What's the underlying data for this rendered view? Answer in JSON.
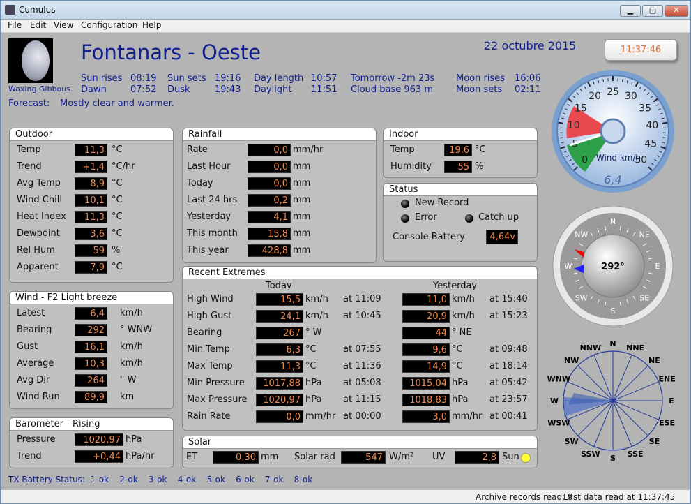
{
  "window": {
    "title": "Cumulus"
  },
  "menu": [
    "File",
    "Edit",
    "View",
    "Configuration",
    "Help"
  ],
  "header": {
    "station": "Fontanars - Oeste",
    "date": "22 octubre 2015",
    "clock": "11:37:46",
    "moon_phase": "Waxing Gibbous",
    "sun_rises_l": "Sun rises",
    "sun_rises": "08:19",
    "sun_sets_l": "Sun sets",
    "sun_sets": "19:16",
    "day_length_l": "Day length",
    "day_length": "10:57",
    "tomorrow": "Tomorrow -2m 23s",
    "moon_rises_l": "Moon rises",
    "moon_rises": "16:06",
    "dawn_l": "Dawn",
    "dawn": "07:52",
    "dusk_l": "Dusk",
    "dusk": "19:43",
    "daylight_l": "Daylight",
    "daylight": "11:51",
    "cloud_base": "Cloud base 963 m",
    "moon_sets_l": "Moon sets",
    "moon_sets": "02:11",
    "forecast_l": "Forecast:",
    "forecast": "Mostly clear and warmer."
  },
  "outdoor": {
    "title": "Outdoor",
    "rows": [
      {
        "label": "Temp",
        "value": "11,3",
        "unit": "°C"
      },
      {
        "label": "Trend",
        "value": "+1,4",
        "unit": "°C/hr"
      },
      {
        "label": "Avg Temp",
        "value": "8,9",
        "unit": "°C"
      },
      {
        "label": "Wind Chill",
        "value": "10,1",
        "unit": "°C"
      },
      {
        "label": "Heat Index",
        "value": "11,3",
        "unit": "°C"
      },
      {
        "label": "Dewpoint",
        "value": "3,6",
        "unit": "°C"
      },
      {
        "label": "Rel Hum",
        "value": "59",
        "unit": "%"
      },
      {
        "label": "Apparent",
        "value": "7,9",
        "unit": "°C"
      }
    ]
  },
  "rainfall": {
    "title": "Rainfall",
    "rows": [
      {
        "label": "Rate",
        "value": "0,0",
        "unit": "mm/hr"
      },
      {
        "label": "Last Hour",
        "value": "0,0",
        "unit": "mm"
      },
      {
        "label": "Today",
        "value": "0,0",
        "unit": "mm"
      },
      {
        "label": "Last 24 hrs",
        "value": "0,2",
        "unit": "mm"
      },
      {
        "label": "Yesterday",
        "value": "4,1",
        "unit": "mm"
      },
      {
        "label": "This month",
        "value": "15,8",
        "unit": "mm"
      },
      {
        "label": "This year",
        "value": "428,8",
        "unit": "mm"
      }
    ]
  },
  "indoor": {
    "title": "Indoor",
    "rows": [
      {
        "label": "Temp",
        "value": "19,6",
        "unit": "°C"
      },
      {
        "label": "Humidity",
        "value": "55",
        "unit": "%"
      }
    ]
  },
  "status": {
    "title": "Status",
    "new_record": "New Record",
    "error": "Error",
    "catch_up": "Catch up",
    "battery_l": "Console Battery",
    "battery": "4,64v"
  },
  "wind": {
    "title": "Wind - F2 Light breeze",
    "rows": [
      {
        "label": "Latest",
        "value": "6,4",
        "unit": "km/h"
      },
      {
        "label": "Bearing",
        "value": "292",
        "unit": "° WNW"
      },
      {
        "label": "Gust",
        "value": "16,1",
        "unit": "km/h"
      },
      {
        "label": "Average",
        "value": "10,3",
        "unit": "km/h"
      },
      {
        "label": "Avg Dir",
        "value": "264",
        "unit": "° W"
      },
      {
        "label": "Wind Run",
        "value": "89,9",
        "unit": "km"
      }
    ]
  },
  "barometer": {
    "title": "Barometer - Rising",
    "rows": [
      {
        "label": "Pressure",
        "value": "1020,97",
        "unit": "hPa"
      },
      {
        "label": "Trend",
        "value": "+0,44",
        "unit": "hPa/hr"
      }
    ]
  },
  "extremes": {
    "title": "Recent Extremes",
    "today_l": "Today",
    "yesterday_l": "Yesterday",
    "rows": [
      {
        "label": "High Wind",
        "t_val": "15,5",
        "t_unit": "km/h",
        "t_at": "at 11:09",
        "y_val": "11,0",
        "y_unit": "km/h",
        "y_at": "at 15:40"
      },
      {
        "label": "High Gust",
        "t_val": "24,1",
        "t_unit": "km/h",
        "t_at": "at 10:45",
        "y_val": "20,9",
        "y_unit": "km/h",
        "y_at": "at 15:23"
      },
      {
        "label": "Bearing",
        "t_val": "267",
        "t_unit": "°  W",
        "t_at": "",
        "y_val": "44",
        "y_unit": "°  NE",
        "y_at": ""
      },
      {
        "label": "Min Temp",
        "t_val": "6,3",
        "t_unit": "°C",
        "t_at": "at 07:55",
        "y_val": "9,6",
        "y_unit": "°C",
        "y_at": "at 09:48"
      },
      {
        "label": "Max Temp",
        "t_val": "11,3",
        "t_unit": "°C",
        "t_at": "at 11:36",
        "y_val": "14,9",
        "y_unit": "°C",
        "y_at": "at 18:14"
      },
      {
        "label": "Min Pressure",
        "t_val": "1017,88",
        "t_unit": "hPa",
        "t_at": "at 05:08",
        "y_val": "1015,04",
        "y_unit": "hPa",
        "y_at": "at 05:42"
      },
      {
        "label": "Max Pressure",
        "t_val": "1020,97",
        "t_unit": "hPa",
        "t_at": "at 11:15",
        "y_val": "1018,83",
        "y_unit": "hPa",
        "y_at": "at 23:57"
      },
      {
        "label": "Rain Rate",
        "t_val": "0,0",
        "t_unit": "mm/hr",
        "t_at": "at 00:00",
        "y_val": "3,0",
        "y_unit": "mm/hr",
        "y_at": "at 00:41"
      }
    ]
  },
  "solar": {
    "title": "Solar",
    "et_l": "ET",
    "et": "0,30",
    "et_u": "mm",
    "rad_l": "Solar rad",
    "rad": "547",
    "rad_u": "W/m²",
    "uv_l": "UV",
    "uv": "2,8",
    "sun": "Sun"
  },
  "tx_battery": "TX Battery Status:  1-ok    2-ok    3-ok    4-ok    5-ok    6-ok    7-ok    8-ok",
  "gauge": {
    "unit": "Wind km/h",
    "value": "6,4",
    "ticks": [
      "0",
      "5",
      "10",
      "15",
      "20",
      "25",
      "30",
      "35",
      "40",
      "45",
      "50"
    ]
  },
  "compass": {
    "bearing": "292°",
    "points": [
      "N",
      "NE",
      "E",
      "SE",
      "S",
      "SW",
      "W",
      "NW"
    ]
  },
  "rose": {
    "points": [
      "N",
      "NNE",
      "NE",
      "ENE",
      "E",
      "ESE",
      "SE",
      "SSE",
      "S",
      "SSW",
      "SW",
      "WSW",
      "W",
      "WNW",
      "NW",
      "NNW"
    ]
  },
  "statusbar": {
    "archive": "Archive records read: 9",
    "last": "Last data read at 11:37:45"
  },
  "colors": {
    "value_text": "#ee8a52",
    "value_bg": "#000000",
    "title_blue": "#102090"
  }
}
